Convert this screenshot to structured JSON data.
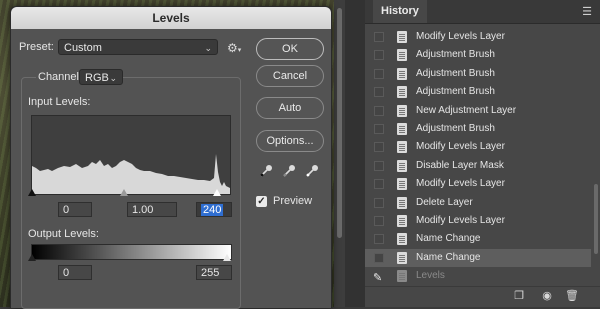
{
  "dialog": {
    "title": "Levels",
    "preset_label": "Preset:",
    "preset_value": "Custom",
    "channel_label": "Channel:",
    "channel_value": "RGB",
    "input_levels_label": "Input Levels:",
    "input_black": "0",
    "input_gamma": "1.00",
    "input_white": "240",
    "output_levels_label": "Output Levels:",
    "output_black": "0",
    "output_white": "255",
    "buttons": {
      "ok": "OK",
      "cancel": "Cancel",
      "auto": "Auto",
      "options": "Options..."
    },
    "preview_label": "Preview",
    "preview_checked": true,
    "icons": [
      "gear-icon",
      "black-eyedropper-icon",
      "gray-eyedropper-icon",
      "white-eyedropper-icon"
    ]
  },
  "history": {
    "tab_label": "History",
    "items": [
      {
        "label": "Modify Levels Layer"
      },
      {
        "label": "Adjustment Brush"
      },
      {
        "label": "Adjustment Brush"
      },
      {
        "label": "Adjustment Brush"
      },
      {
        "label": "New Adjustment Layer"
      },
      {
        "label": "Adjustment Brush"
      },
      {
        "label": "Modify Levels Layer"
      },
      {
        "label": "Disable Layer Mask"
      },
      {
        "label": "Modify Levels Layer"
      },
      {
        "label": "Delete Layer"
      },
      {
        "label": "Modify Levels Layer"
      },
      {
        "label": "Name Change"
      },
      {
        "label": "Name Change"
      },
      {
        "label": "Levels"
      }
    ],
    "footer_icons": [
      "new-document-from-state-icon",
      "snapshot-camera-icon",
      "trash-icon"
    ]
  },
  "colors": {
    "dialog_bg": "#535353",
    "panel_bg": "#474747",
    "selection_blue": "#2f6ed1"
  }
}
